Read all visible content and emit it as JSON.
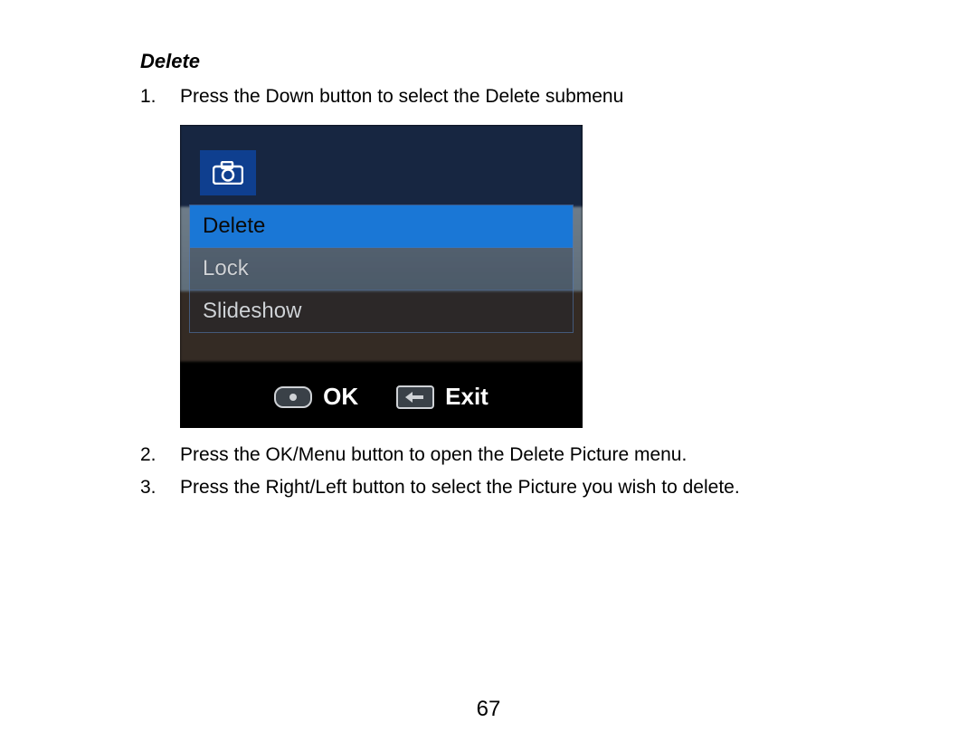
{
  "heading": "Delete",
  "steps": [
    {
      "num": "1.",
      "text": "Press the Down button to select the Delete submenu"
    },
    {
      "num": "2.",
      "text": "Press the OK/Menu button to open the Delete Picture menu."
    },
    {
      "num": "3.",
      "text": "Press the Right/Left button to select the Picture you wish to delete."
    }
  ],
  "lcd": {
    "tab_icon": "camera-icon",
    "menu": {
      "items": [
        {
          "label": "Delete",
          "selected": true
        },
        {
          "label": "Lock",
          "selected": false
        },
        {
          "label": "Slideshow",
          "selected": false
        }
      ]
    },
    "bottom": {
      "ok_label": "OK",
      "exit_label": "Exit"
    }
  },
  "page_number": "67"
}
